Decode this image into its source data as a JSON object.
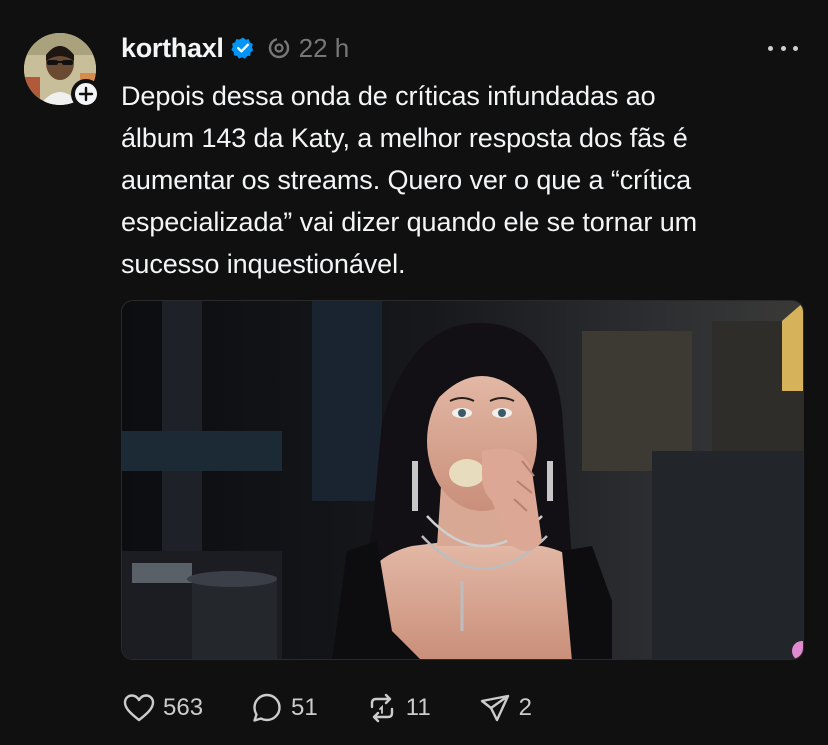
{
  "post": {
    "username": "korthaxl",
    "verified": true,
    "time": "22 h",
    "text": "Depois dessa onda de críticas infundadas ao\nálbum 143 da Katy, a melhor resposta dos fãs é\naumentar os streams. Quero ver o que a “crítica\nespecializada” vai dizer quando ele se tornar um\nsucesso inquestionável.",
    "media": {
      "type": "image"
    }
  },
  "actions": {
    "likes": "563",
    "replies": "51",
    "reposts": "11",
    "shares": "2"
  },
  "icons": {
    "verified": "verified-badge-icon",
    "thread": "thread-activity-icon",
    "more": "more-options-icon",
    "follow": "plus-icon",
    "like": "heart-icon",
    "reply": "speech-bubble-icon",
    "repost": "repost-icon",
    "share": "paper-plane-icon"
  },
  "colors": {
    "background": "#101010",
    "text": "#f3f5f7",
    "muted": "#777777",
    "verified": "#0095f6"
  }
}
